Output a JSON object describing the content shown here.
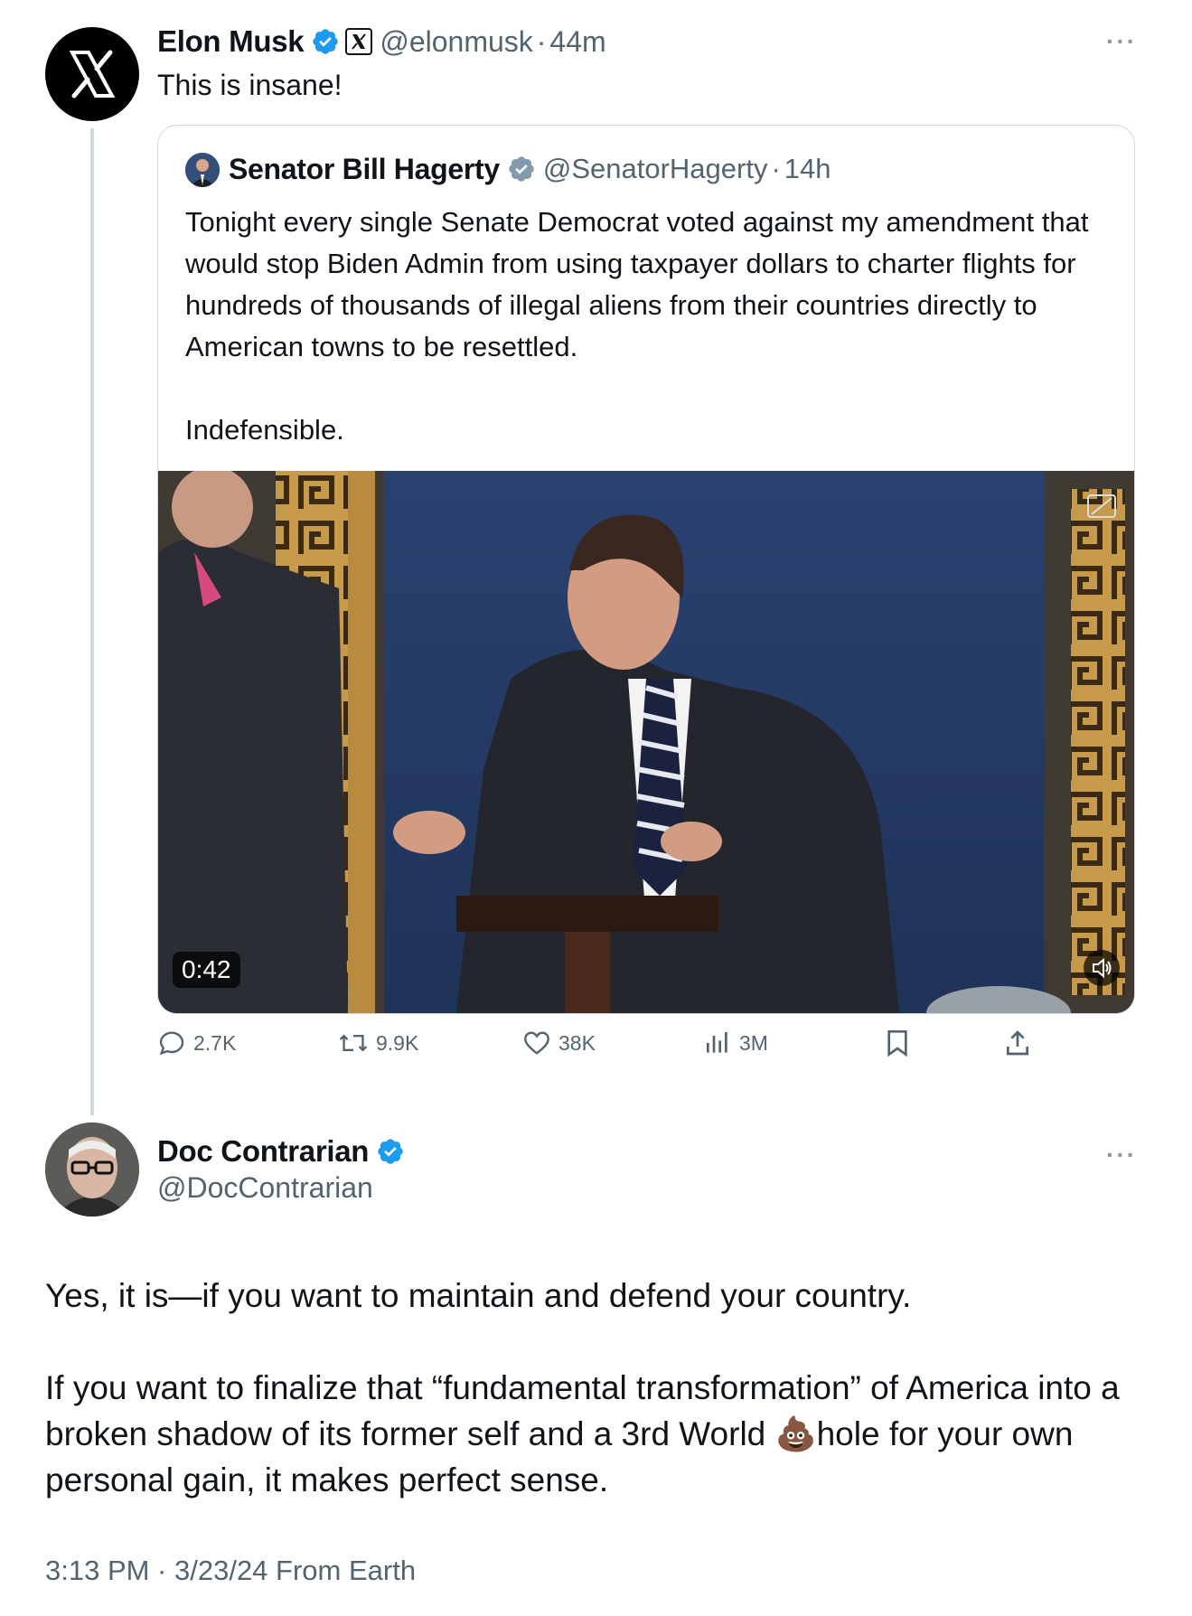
{
  "main_tweet": {
    "author_name": "Elon Musk",
    "handle": "@elonmusk",
    "separator": "·",
    "time": "44m",
    "text": "This is insane!",
    "avatar_icon": "x-logo-icon"
  },
  "quoted_tweet": {
    "author_name": "Senator Bill Hagerty",
    "handle": "@SenatorHagerty",
    "separator": "·",
    "time": "14h",
    "text": "Tonight every single Senate Democrat voted against my amendment that would stop Biden Admin from using taxpayer dollars to charter flights for hundreds of thousands of illegal aliens from their countries directly to American towns to be resettled.\n\nIndefensible.",
    "video_duration": "0:42"
  },
  "actions": {
    "replies": "2.7K",
    "reposts": "9.9K",
    "likes": "38K",
    "views": "3M"
  },
  "reply_tweet": {
    "author_name": "Doc Contrarian",
    "handle": "@DocContrarian",
    "text_1": "Yes, it is—if you want to maintain and defend your country.",
    "text_2": "If you want to finalize that “fundamental transformation” of America into a broken shadow of its former self and a 3rd World 💩hole for your own personal gain, it makes perfect sense.",
    "footer": "3:13 PM · 3/23/24 From Earth"
  },
  "colors": {
    "verified_blue": "#1d9bf0",
    "verified_gray": "#829aab",
    "muted": "#536471",
    "border": "#cfd9de"
  }
}
